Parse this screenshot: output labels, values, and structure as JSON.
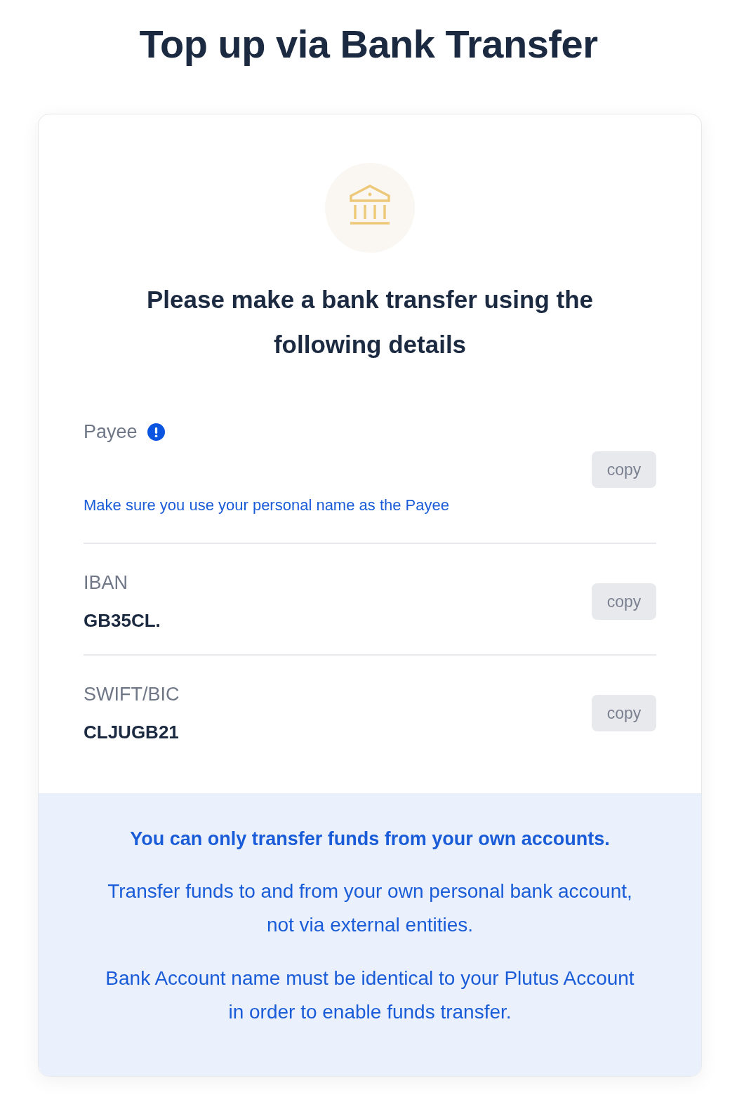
{
  "title": "Top up via Bank Transfer",
  "card": {
    "heading": "Please make a bank transfer using the following details",
    "fields": [
      {
        "kind": "hint",
        "label": "Payee",
        "alert": true,
        "hint": "Make sure you use your personal name as the Payee",
        "copy_button": "copy"
      },
      {
        "kind": "value",
        "label": "IBAN",
        "alert": false,
        "value": "GB35CL.",
        "copy_button": "copy"
      },
      {
        "kind": "value",
        "label": "SWIFT/BIC",
        "alert": false,
        "value": "CLJUGB21",
        "copy_button": "copy"
      }
    ],
    "notice": {
      "title": "You can only transfer funds from your own accounts.",
      "paragraphs": [
        "Transfer funds to and from your own personal bank account, not via external entities.",
        "Bank Account name must be identical to your Plutus Account in order to enable funds transfer."
      ]
    }
  }
}
